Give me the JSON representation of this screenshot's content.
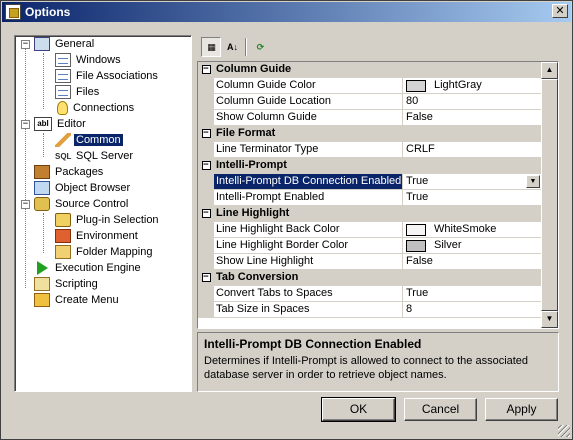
{
  "window": {
    "title": "Options"
  },
  "tree": [
    {
      "label": "General",
      "icon": "monitor-icon"
    },
    {
      "label": "Windows",
      "icon": "document-icon"
    },
    {
      "label": "File Associations",
      "icon": "document-link-icon"
    },
    {
      "label": "Files",
      "icon": "files-icon"
    },
    {
      "label": "Connections",
      "icon": "lightbulb-icon"
    },
    {
      "label": "Editor",
      "icon": "textbox-icon"
    },
    {
      "label": "Common",
      "icon": "pencil-icon"
    },
    {
      "label": "SQL Server",
      "icon": "sql-icon"
    },
    {
      "label": "Packages",
      "icon": "package-icon"
    },
    {
      "label": "Object Browser",
      "icon": "object-browser-icon"
    },
    {
      "label": "Source Control",
      "icon": "lock-icon"
    },
    {
      "label": "Plug-in Selection",
      "icon": "plugin-icon"
    },
    {
      "label": "Environment",
      "icon": "house-icon"
    },
    {
      "label": "Folder Mapping",
      "icon": "folder-icon"
    },
    {
      "label": "Execution Engine",
      "icon": "play-icon"
    },
    {
      "label": "Scripting",
      "icon": "script-icon"
    },
    {
      "label": "Create Menu",
      "icon": "menu-icon"
    }
  ],
  "toolbar": {
    "categorized_icon": "categorized-icon",
    "alphabetical_icon": "alphabetical-sort-icon",
    "refresh_icon": "refresh-icon"
  },
  "grid": {
    "categories": [
      {
        "title": "Column Guide",
        "rows": [
          {
            "name": "Column Guide Color",
            "value": "LightGray",
            "swatch": "#d3d3d3"
          },
          {
            "name": "Column Guide Location",
            "value": "80"
          },
          {
            "name": "Show Column Guide",
            "value": "False"
          }
        ]
      },
      {
        "title": "File Format",
        "rows": [
          {
            "name": "Line Terminator Type",
            "value": "CRLF"
          }
        ]
      },
      {
        "title": "Intelli-Prompt",
        "rows": [
          {
            "name": "Intelli-Prompt DB Connection Enabled",
            "value": "True"
          },
          {
            "name": "Intelli-Prompt Enabled",
            "value": "True"
          }
        ]
      },
      {
        "title": "Line Highlight",
        "rows": [
          {
            "name": "Line Highlight Back Color",
            "value": "WhiteSmoke",
            "swatch": "#f5f5f5"
          },
          {
            "name": "Line Highlight Border Color",
            "value": "Silver",
            "swatch": "#c0c0c0"
          },
          {
            "name": "Show Line Highlight",
            "value": "False"
          }
        ]
      },
      {
        "title": "Tab Conversion",
        "rows": [
          {
            "name": "Convert Tabs to Spaces",
            "value": "True"
          },
          {
            "name": "Tab Size in Spaces",
            "value": "8"
          }
        ]
      }
    ]
  },
  "description": {
    "title": "Intelli-Prompt DB Connection Enabled",
    "text": "Determines if Intelli-Prompt is allowed to connect to the associated database server in order to retrieve object names."
  },
  "buttons": {
    "ok": "OK",
    "cancel": "Cancel",
    "apply": "Apply"
  },
  "colors": {
    "selection": "#0a246a",
    "face": "#d4d0c8"
  }
}
